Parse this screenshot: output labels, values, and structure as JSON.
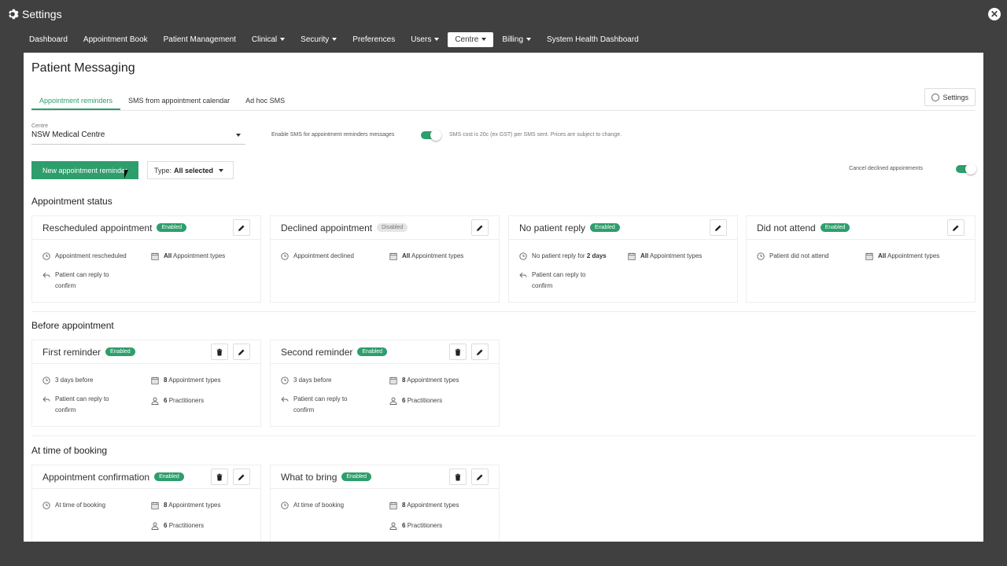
{
  "app": {
    "title": "Settings"
  },
  "nav": {
    "items": [
      {
        "label": "Dashboard",
        "dropdown": false,
        "active": false
      },
      {
        "label": "Appointment Book",
        "dropdown": false,
        "active": false
      },
      {
        "label": "Patient Management",
        "dropdown": false,
        "active": false
      },
      {
        "label": "Clinical",
        "dropdown": true,
        "active": false
      },
      {
        "label": "Security",
        "dropdown": true,
        "active": false
      },
      {
        "label": "Preferences",
        "dropdown": false,
        "active": false
      },
      {
        "label": "Users",
        "dropdown": true,
        "active": false
      },
      {
        "label": "Centre",
        "dropdown": true,
        "active": true
      },
      {
        "label": "Billing",
        "dropdown": true,
        "active": false
      },
      {
        "label": "System Health Dashboard",
        "dropdown": false,
        "active": false
      }
    ]
  },
  "page": {
    "title": "Patient Messaging",
    "tabs": [
      "Appointment reminders",
      "SMS from appointment calendar",
      "Ad hoc SMS"
    ],
    "settings_label": "Settings",
    "centre_label": "Centre",
    "centre_value": "NSW Medical Centre",
    "enable_sms_label": "Enable SMS for appointment reminders messages",
    "sms_cost": "SMS cost is 20c (ex GST) per SMS sent. Prices are subject to change.",
    "new_button": "New appointment reminder",
    "type_prefix": "Type:",
    "type_value": "All selected",
    "cancel_declined_label": "Cancel declined appointments"
  },
  "sections": {
    "status": "Appointment status",
    "before": "Before appointment",
    "booking": "At time of booking"
  },
  "cards": {
    "rescheduled": {
      "name": "Rescheduled appointment",
      "badge": "Enabled",
      "when": "Appointment rescheduled",
      "types_bold": "All",
      "types_rest": "Appointment types",
      "reply": "Patient can reply to confirm"
    },
    "declined": {
      "name": "Declined appointment",
      "badge": "Disabled",
      "when": "Appointment declined",
      "types_bold": "All",
      "types_rest": "Appointment types"
    },
    "noreply": {
      "name": "No patient reply",
      "badge": "Enabled",
      "when_pre": "No patient reply for",
      "when_bold": "2 days",
      "types_bold": "All",
      "types_rest": "Appointment types",
      "reply": "Patient can reply to confirm"
    },
    "dna": {
      "name": "Did not attend",
      "badge": "Enabled",
      "when": "Patient did not attend",
      "types_bold": "All",
      "types_rest": "Appointment types"
    },
    "first": {
      "name": "First reminder",
      "badge": "Enabled",
      "when": "3 days before",
      "types_bold": "8",
      "types_rest": "Appointment types",
      "reply": "Patient can reply to confirm",
      "prac_bold": "6",
      "prac_rest": "Practitioners"
    },
    "second": {
      "name": "Second reminder",
      "badge": "Enabled",
      "when": "3 days before",
      "types_bold": "8",
      "types_rest": "Appointment types",
      "reply": "Patient can reply to confirm",
      "prac_bold": "6",
      "prac_rest": "Practitioners"
    },
    "confirm": {
      "name": "Appointment confirmation",
      "badge": "Enabled",
      "when": "At time of booking",
      "types_bold": "8",
      "types_rest": "Appointment types",
      "prac_bold": "6",
      "prac_rest": "Practitioners"
    },
    "bring": {
      "name": "What to bring",
      "badge": "Enabled",
      "when": "At time of booking",
      "types_bold": "8",
      "types_rest": "Appointment types",
      "prac_bold": "6",
      "prac_rest": "Practitioners"
    }
  },
  "colors": {
    "accent": "#2e9e6c",
    "background": "#404040"
  }
}
